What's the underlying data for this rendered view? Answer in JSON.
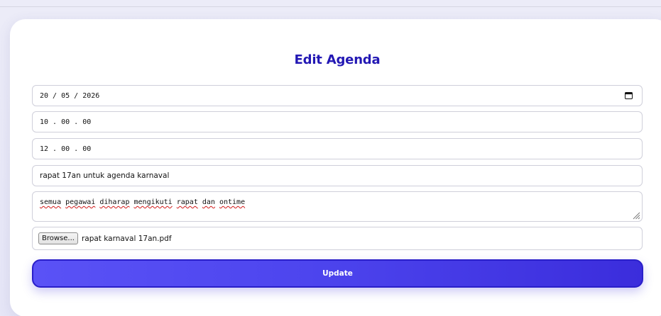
{
  "form": {
    "title": "Edit Agenda",
    "date_value": "20 / 05 / 2026",
    "start_time_value": "10 . 00 . 00",
    "end_time_value": "12 . 00 . 00",
    "agenda_title_value": "rapat 17an untuk agenda karnaval",
    "description_words": [
      "semua",
      "pegawai",
      "diharap",
      "mengikuti",
      "rapat",
      "dan",
      "ontime"
    ],
    "file": {
      "browse_label": "Browse...",
      "selected_file": "rapat karnaval 17an.pdf"
    },
    "submit_label": "Update"
  },
  "colors": {
    "title": "#2318b4",
    "button_start": "#5a52f6",
    "button_end": "#3b2ddc",
    "background": "#ececf8"
  },
  "icons": {
    "date_picker": "calendar-icon",
    "textarea_resize": "resize-grip-icon"
  }
}
